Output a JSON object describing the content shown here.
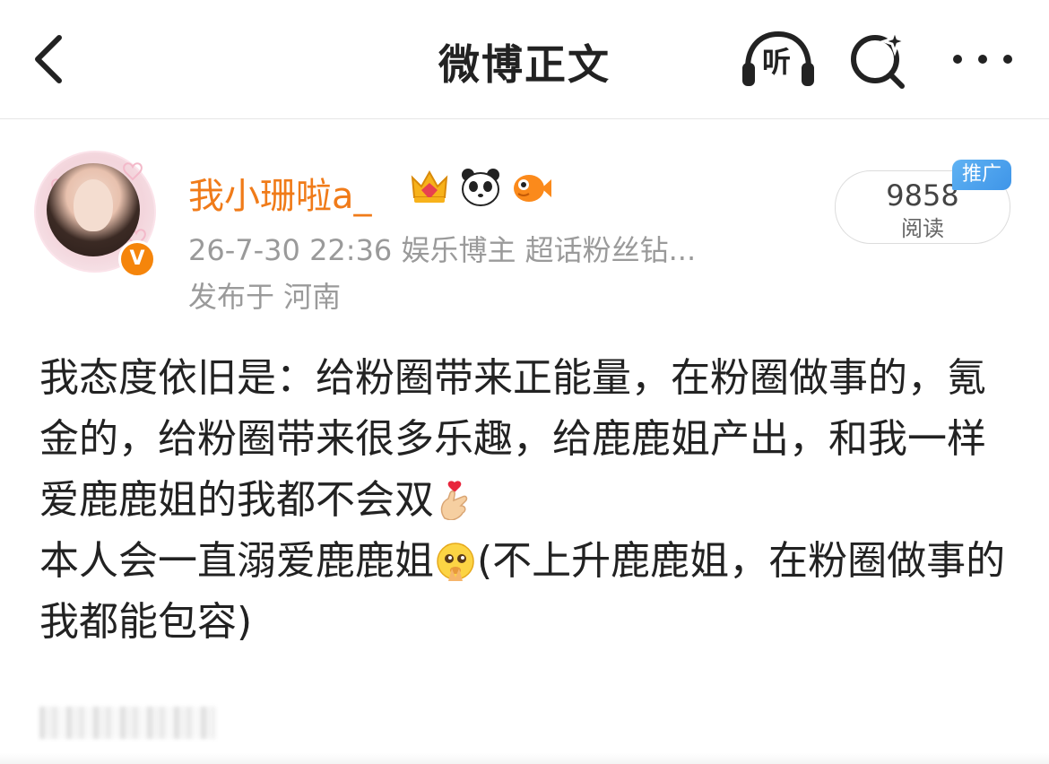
{
  "nav": {
    "title": "微博正文",
    "listen_label": "听"
  },
  "post": {
    "author": "我小珊啦a_",
    "meta": "26-7-30 22:36  娱乐博主 超话粉丝钻...",
    "location": "发布于 河南",
    "read_count": "9858",
    "read_label": "阅读",
    "promo_tag": "推广",
    "verified_mark": "V",
    "body_line1": "我态度依旧是：给粉圈带来正能量，在粉圈做事的，氪金的，给粉圈带来很多乐趣，给鹿鹿姐产出，和我一样爱鹿鹿姐的我都不会双",
    "body_line2_a": "本人会一直溺爱鹿鹿姐",
    "body_line2_b": "(不上升鹿鹿姐，在粉圈做事的我都能包容)"
  },
  "colors": {
    "username": "#f07b19",
    "meta": "#9a9a9a",
    "verified": "#f5850b",
    "promo": "#3f95e8"
  },
  "icons": [
    "back-arrow-icon",
    "listen-headphone-icon",
    "search-sparkle-icon",
    "more-dots-icon",
    "crown-badge-icon",
    "panda-badge-icon",
    "fish-badge-icon",
    "finger-heart-emoji-icon",
    "pleading-face-emoji-icon"
  ]
}
